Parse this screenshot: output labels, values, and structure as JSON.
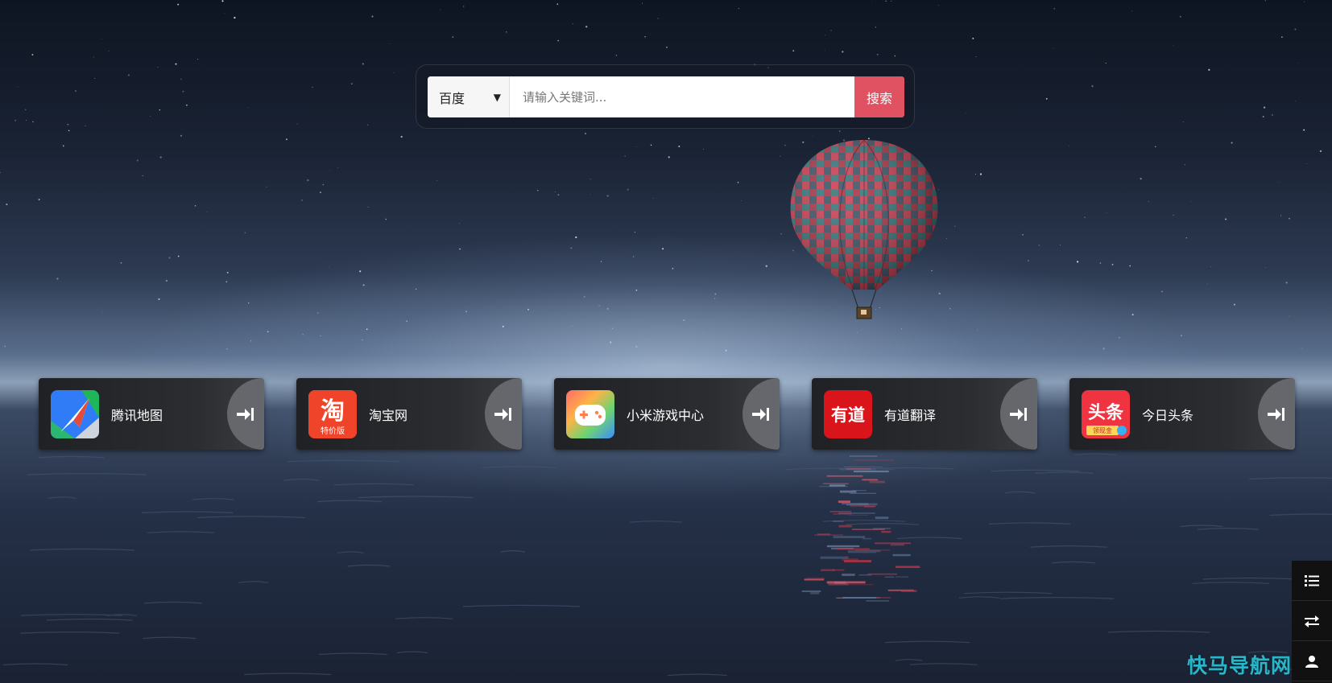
{
  "search": {
    "engine_selected": "百度",
    "placeholder": "请输入关键词...",
    "button_label": "搜索"
  },
  "cards": [
    {
      "label": "腾讯地图",
      "icon": "tencent-map-icon"
    },
    {
      "label": "淘宝网",
      "icon": "taobao-icon",
      "icon_text": "淘",
      "icon_subtext": "特价版"
    },
    {
      "label": "小米游戏中心",
      "icon": "xiaomi-game-icon"
    },
    {
      "label": "有道翻译",
      "icon": "youdao-icon",
      "icon_text": "有道"
    },
    {
      "label": "今日头条",
      "icon": "toutiao-icon",
      "icon_text": "头条",
      "icon_subtext": "领现金"
    }
  ],
  "side_toolbar": {
    "items": [
      "list-icon",
      "swap-icon",
      "user-icon"
    ]
  },
  "watermark": "快马导航网",
  "colors": {
    "search_button": "#e05162",
    "card_bg": "#2b2d31",
    "watermark": "#29b6c8"
  }
}
